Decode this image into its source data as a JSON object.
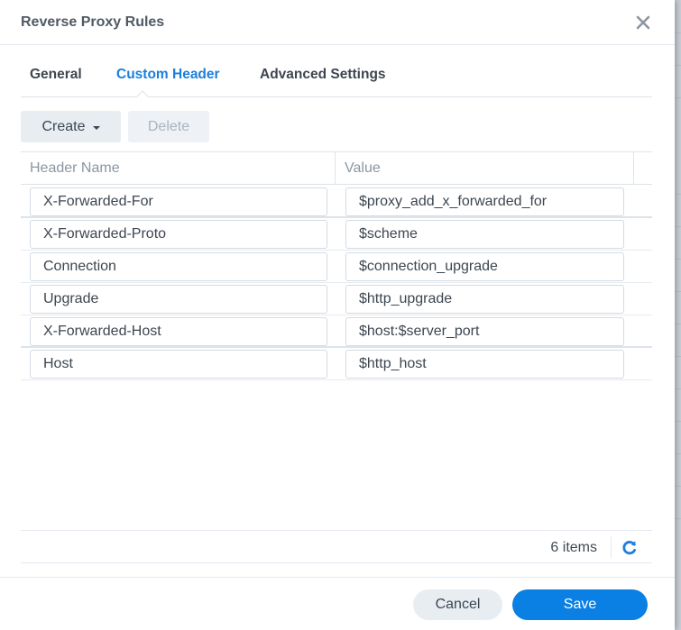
{
  "dialog": {
    "title": "Reverse Proxy Rules",
    "close_icon": "close-icon"
  },
  "tabs": [
    {
      "label": "General",
      "active": false
    },
    {
      "label": "Custom Header",
      "active": true
    },
    {
      "label": "Advanced Settings",
      "active": false
    }
  ],
  "toolbar": {
    "create_label": "Create",
    "create_icon": "caret-down-icon",
    "delete_label": "Delete",
    "delete_disabled": true
  },
  "grid": {
    "columns": [
      "Header Name",
      "Value"
    ],
    "rows": [
      {
        "name": "X-Forwarded-For",
        "value": "$proxy_add_x_forwarded_for"
      },
      {
        "name": "X-Forwarded-Proto",
        "value": "$scheme"
      },
      {
        "name": "Connection",
        "value": "$connection_upgrade"
      },
      {
        "name": "Upgrade",
        "value": "$http_upgrade"
      },
      {
        "name": "X-Forwarded-Host",
        "value": "$host:$server_port"
      },
      {
        "name": "Host",
        "value": "$http_host"
      }
    ],
    "item_count": "6 items",
    "refresh_icon": "refresh-icon"
  },
  "actions": {
    "cancel_label": "Cancel",
    "save_label": "Save"
  },
  "colors": {
    "accent": "#1b7fdc",
    "primary_button": "#0a7fe4",
    "secondary_button": "#e8edf2"
  }
}
